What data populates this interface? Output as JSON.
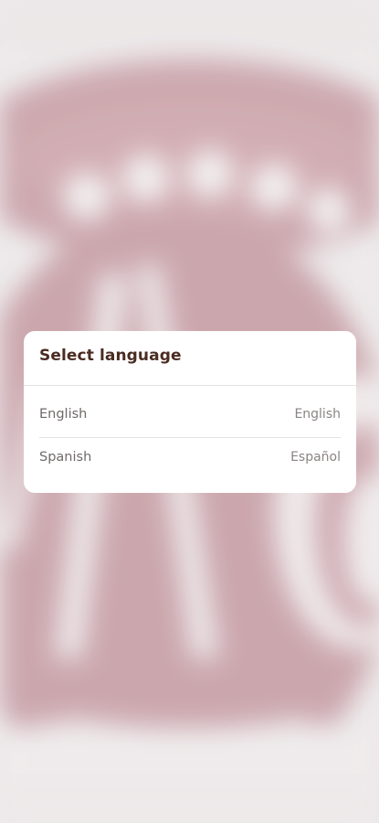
{
  "dialog": {
    "title": "Select language",
    "options": [
      {
        "label": "English",
        "native": "English"
      },
      {
        "label": "Spanish",
        "native": "Español"
      }
    ]
  },
  "colors": {
    "background_accent": "#c9a2a9",
    "background_base": "#ece9ea",
    "title_color": "#4a2c22",
    "text_color": "#6f6a68"
  }
}
